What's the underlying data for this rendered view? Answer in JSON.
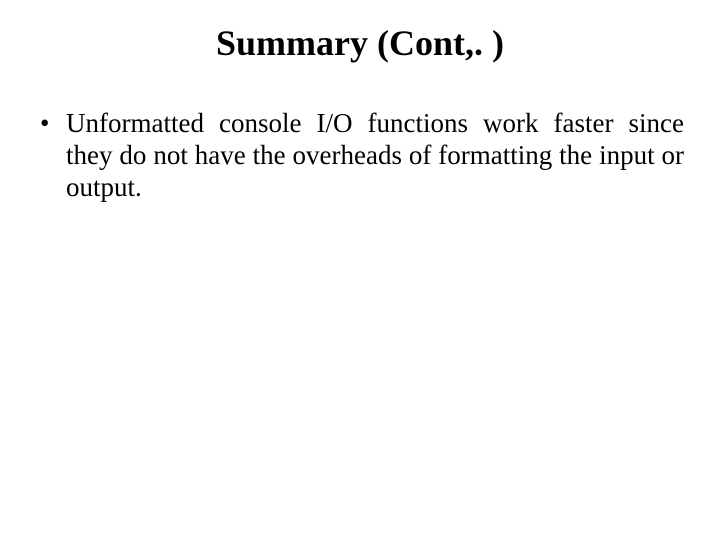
{
  "slide": {
    "title": "Summary (Cont,. )",
    "bullets": [
      "Unformatted console I/O functions work faster since they do not have the overheads of formatting the input or output."
    ]
  }
}
